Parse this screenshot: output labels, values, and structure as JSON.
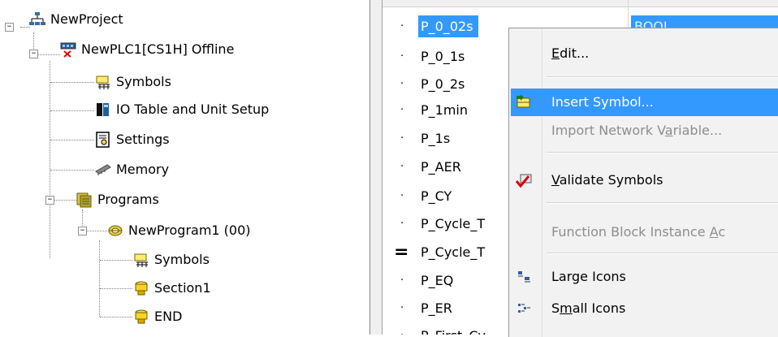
{
  "tree": {
    "nodes": [
      {
        "label": "NewProject",
        "icon": "network-project-icon",
        "toggle": "−"
      },
      {
        "label": "NewPLC1[CS1H] Offline",
        "icon": "plc-offline-icon",
        "toggle": "−"
      },
      {
        "label": "Symbols",
        "icon": "symbols-table-icon"
      },
      {
        "label": "IO Table and Unit Setup",
        "icon": "io-table-icon"
      },
      {
        "label": "Settings",
        "icon": "settings-icon"
      },
      {
        "label": "Memory",
        "icon": "memory-chip-icon"
      },
      {
        "label": "Programs",
        "icon": "programs-icon",
        "toggle": "−"
      },
      {
        "label": "NewProgram1 (00)",
        "icon": "program-icon",
        "toggle": "−"
      },
      {
        "label": "Symbols",
        "icon": "symbols-table-icon"
      },
      {
        "label": "Section1",
        "icon": "section-icon"
      },
      {
        "label": "END",
        "icon": "section-icon"
      }
    ]
  },
  "list": {
    "rows": [
      {
        "bullet": "·",
        "name": "P_0_02s",
        "type": "BOOL",
        "selected": true
      },
      {
        "bullet": "·",
        "name": "P_0_1s"
      },
      {
        "bullet": "·",
        "name": "P_0_2s"
      },
      {
        "bullet": "·",
        "name": "P_1min"
      },
      {
        "bullet": "·",
        "name": "P_1s"
      },
      {
        "bullet": "·",
        "name": "P_AER"
      },
      {
        "bullet": "·",
        "name": "P_CY"
      },
      {
        "bullet": "·",
        "name": "P_Cycle_T"
      },
      {
        "bullet": "=",
        "name": "P_Cycle_T"
      },
      {
        "bullet": "·",
        "name": "P_EQ"
      },
      {
        "bullet": "·",
        "name": "P_ER"
      },
      {
        "bullet": "·",
        "name": "P_First_Cy"
      }
    ]
  },
  "menu": {
    "items": [
      {
        "label": "Edit...",
        "accel": "E",
        "state": "normal"
      },
      {
        "label": "Insert Symbol...",
        "accel": "",
        "state": "highlighted",
        "icon": "insert-symbol-icon"
      },
      {
        "label": "Import Network Variable...",
        "accel": "a",
        "state": "disabled"
      },
      {
        "label": "Validate Symbols",
        "accel": "V",
        "state": "normal",
        "icon": "validate-check-icon"
      },
      {
        "label": "Function Block Instance Ac",
        "accel": "A",
        "state": "disabled"
      },
      {
        "label": "Large Icons",
        "accel": "",
        "state": "normal",
        "icon": "large-icons-icon"
      },
      {
        "label": "Small Icons",
        "accel": "m",
        "state": "normal",
        "icon": "small-icons-icon"
      }
    ]
  },
  "colors": {
    "selection": "#3399ff",
    "menu_bg": "#f2f2f2",
    "disabled_text": "#8d8d8d"
  }
}
